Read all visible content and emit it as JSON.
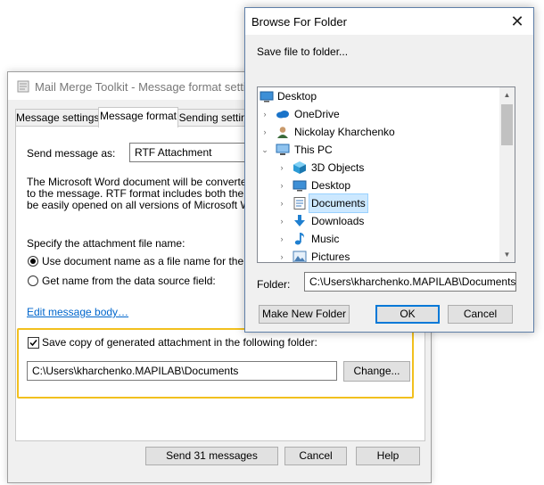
{
  "mail_merge": {
    "title": "Mail Merge Toolkit - Message format settings",
    "tabs": [
      "Message settings",
      "Message format",
      "Sending settings"
    ],
    "send_as_label": "Send message as:",
    "send_as_value": "RTF Attachment",
    "description_lines": [
      "The Microsoft Word document will be converted into",
      "to the message. RTF format includes both the text",
      "be easily opened on all versions of Microsoft Word"
    ],
    "attachment_name_label": "Specify the attachment file name:",
    "radio_use_doc_name": "Use document name as a file name for the attachment",
    "radio_get_name": "Get name from the data source field:",
    "edit_body_link": "Edit message body…",
    "save_copy_checkbox": "Save copy of generated attachment in the following folder:",
    "save_copy_checked": true,
    "folder_path": "C:\\Users\\kharchenko.MAPILAB\\Documents",
    "change_button": "Change...",
    "send_button": "Send 31 messages",
    "cancel_button": "Cancel",
    "help_button": "Help"
  },
  "browse": {
    "title": "Browse For Folder",
    "close_glyph": "✕",
    "prompt": "Save file to folder...",
    "tree": [
      {
        "label": "Desktop",
        "icon": "desktop-icon",
        "expander": ""
      },
      {
        "label": "OneDrive",
        "icon": "cloud-icon",
        "expander": "›"
      },
      {
        "label": "Nickolay Kharchenko",
        "icon": "user-icon",
        "expander": "›"
      },
      {
        "label": "This PC",
        "icon": "computer-icon",
        "expander": "⌄"
      },
      {
        "label": "3D Objects",
        "icon": "cube-icon",
        "expander": "›"
      },
      {
        "label": "Desktop",
        "icon": "desktop-folder-icon",
        "expander": "›"
      },
      {
        "label": "Documents",
        "icon": "documents-icon",
        "expander": "›",
        "selected": true
      },
      {
        "label": "Downloads",
        "icon": "download-icon",
        "expander": "›"
      },
      {
        "label": "Music",
        "icon": "music-icon",
        "expander": "›"
      },
      {
        "label": "Pictures",
        "icon": "pictures-icon",
        "expander": "›"
      }
    ],
    "folder_label": "Folder:",
    "folder_value": "C:\\Users\\kharchenko.MAPILAB\\Documents",
    "new_folder_button": "Make New Folder",
    "ok_button": "OK",
    "cancel_button": "Cancel"
  },
  "colors": {
    "highlight": "#f2c01e",
    "link": "#0066cc",
    "selection": "#cce8ff",
    "default_button_border": "#0078d7"
  }
}
